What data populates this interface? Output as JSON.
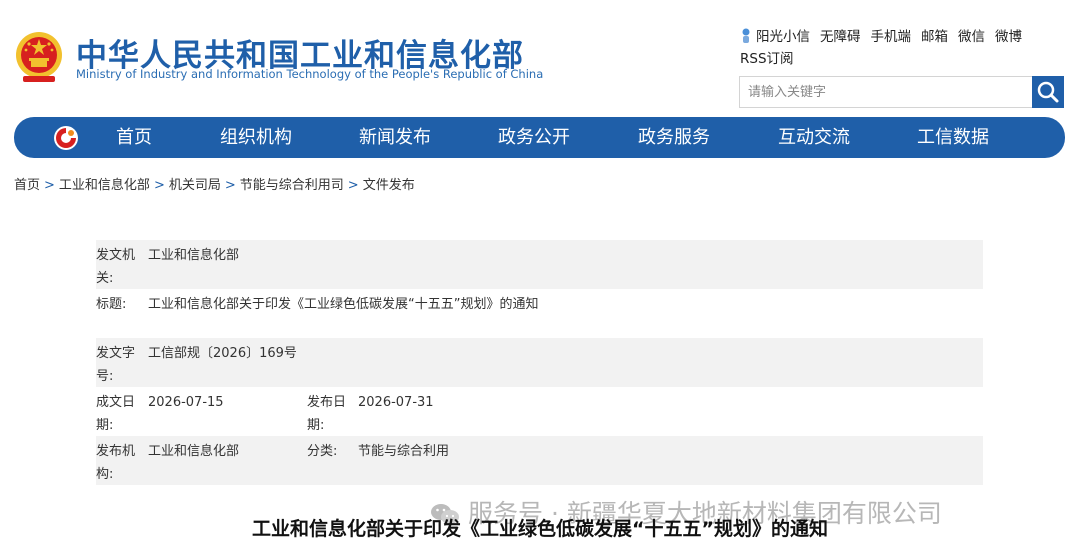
{
  "header": {
    "title_cn": "中华人民共和国工业和信息化部",
    "title_en": "Ministry of Industry and Information Technology of the People's Republic of China",
    "links": [
      "阳光小信",
      "无障碍",
      "手机端",
      "邮箱",
      "微信",
      "微博",
      "RSS订阅"
    ],
    "search_placeholder": "请输入关键字"
  },
  "nav": {
    "items": [
      "首页",
      "组织机构",
      "新闻发布",
      "政务公开",
      "政务服务",
      "互动交流",
      "工信数据"
    ]
  },
  "breadcrumb": [
    "首页",
    "工业和信息化部",
    "机关司局",
    "节能与综合利用司",
    "文件发布"
  ],
  "info": {
    "issuer_label": "发文机关:",
    "issuer": "工业和信息化部",
    "title_label": "标题:",
    "title": "工业和信息化部关于印发《工业绿色低碳发展“十五五”规划》的通知",
    "docno_label": "发文字号:",
    "docno": "工信部规〔2026〕169号",
    "created_label": "成文日期:",
    "created": "2026-07-15",
    "published_label": "发布日期:",
    "published": "2026-07-31",
    "publisher_label": "发布机构:",
    "publisher": "工业和信息化部",
    "category_label": "分类:",
    "category": "节能与综合利用"
  },
  "article": {
    "title": "工业和信息化部关于印发《工业绿色低碳发展“十五五”规划》的通知"
  },
  "watermark": {
    "text": "服务号 · 新疆华夏大地新材料集团有限公司"
  },
  "colors": {
    "brand": "#1f5fa9",
    "emblem_red": "#d7201f",
    "emblem_gold": "#f2c12e"
  }
}
